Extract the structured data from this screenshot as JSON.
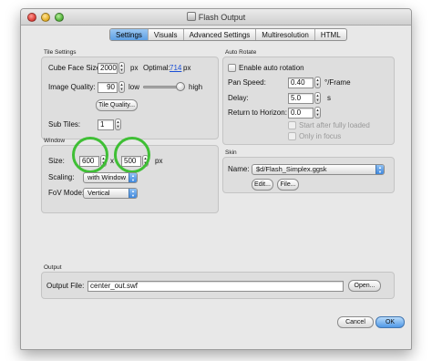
{
  "window": {
    "title": "Flash Output"
  },
  "tabs": [
    {
      "label": "Settings",
      "active": true
    },
    {
      "label": "Visuals",
      "active": false
    },
    {
      "label": "Advanced Settings",
      "active": false
    },
    {
      "label": "Multiresolution",
      "active": false
    },
    {
      "label": "HTML",
      "active": false
    }
  ],
  "tile_settings": {
    "title": "Tile Settings",
    "cube_face_size_label": "Cube Face Size:",
    "cube_face_size_value": "2000",
    "cube_face_unit": "px",
    "optimal_label": "Optimal:",
    "optimal_value": "714",
    "optimal_unit": "px",
    "image_quality_label": "Image Quality:",
    "image_quality_value": "90",
    "image_quality_level": 0.9,
    "low_label": "low",
    "high_label": "high",
    "tile_quality_button": "Tile Quality...",
    "sub_tiles_label": "Sub Tiles:",
    "sub_tiles_value": "1"
  },
  "window_group": {
    "title": "Window",
    "size_label": "Size:",
    "width_value": "600",
    "x_label": "x",
    "height_value": "500",
    "size_unit": "px",
    "scaling_label": "Scaling:",
    "scaling_value": "with Window",
    "fov_mode_label": "FoV Mode:",
    "fov_mode_value": "Vertical"
  },
  "auto_rotate": {
    "title": "Auto Rotate",
    "enable_label": "Enable auto rotation",
    "pan_speed_label": "Pan Speed:",
    "pan_speed_value": "0.40",
    "pan_speed_unit": "°/Frame",
    "delay_label": "Delay:",
    "delay_value": "5.0",
    "delay_unit": "s",
    "return_label": "Return to Horizon:",
    "return_value": "0.0",
    "start_after_loaded_label": "Start after fully loaded",
    "only_in_focus_label": "Only in focus"
  },
  "skin": {
    "title": "Skin",
    "name_label": "Name:",
    "name_value": "$d/Flash_Simplex.ggsk",
    "edit_button": "Edit...",
    "file_button": "File..."
  },
  "output": {
    "title": "Output",
    "output_file_label": "Output File:",
    "output_file_value": "center_out.swf",
    "open_button": "Open..."
  },
  "footer": {
    "cancel_button": "Cancel",
    "ok_button": "OK"
  }
}
